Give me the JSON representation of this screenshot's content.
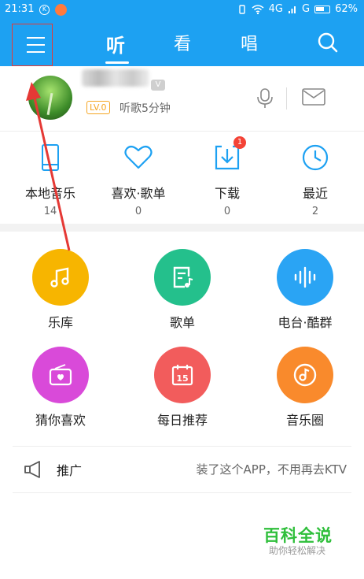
{
  "status": {
    "time": "21:31",
    "network_left": "4G",
    "network_right": "G",
    "battery": "62%"
  },
  "tabs": [
    {
      "label": "听",
      "active": true
    },
    {
      "label": "看",
      "active": false
    },
    {
      "label": "唱",
      "active": false
    }
  ],
  "profile": {
    "level": "LV.0",
    "listen_time": "听歌5分钟"
  },
  "quick": [
    {
      "label": "本地音乐",
      "count": "14",
      "icon": "phone-icon"
    },
    {
      "label": "喜欢·歌单",
      "count": "0",
      "icon": "heart-icon"
    },
    {
      "label": "下载",
      "count": "0",
      "icon": "download-icon",
      "badge": "1"
    },
    {
      "label": "最近",
      "count": "2",
      "icon": "clock-icon"
    }
  ],
  "grid": [
    {
      "label": "乐库",
      "color": "#f7b500",
      "icon": "music-note-icon"
    },
    {
      "label": "歌单",
      "color": "#24c08c",
      "icon": "playlist-icon"
    },
    {
      "label": "电台·酷群",
      "color": "#2aa4f4",
      "icon": "sound-wave-icon"
    },
    {
      "label": "猜你喜欢",
      "color": "#d94ad9",
      "icon": "radio-icon"
    },
    {
      "label": "每日推荐",
      "color": "#f25c5c",
      "icon": "calendar-icon"
    },
    {
      "label": "音乐圈",
      "color": "#f98a2c",
      "icon": "music-circle-icon"
    }
  ],
  "calendar_day": "15",
  "promo": {
    "title": "推广",
    "desc": "装了这个APP，不用再去KTV"
  },
  "watermark": {
    "title": "百科全说",
    "subtitle": "助你轻松解决"
  },
  "colors": {
    "brand": "#1da1f2",
    "annotation": "#e53935"
  }
}
